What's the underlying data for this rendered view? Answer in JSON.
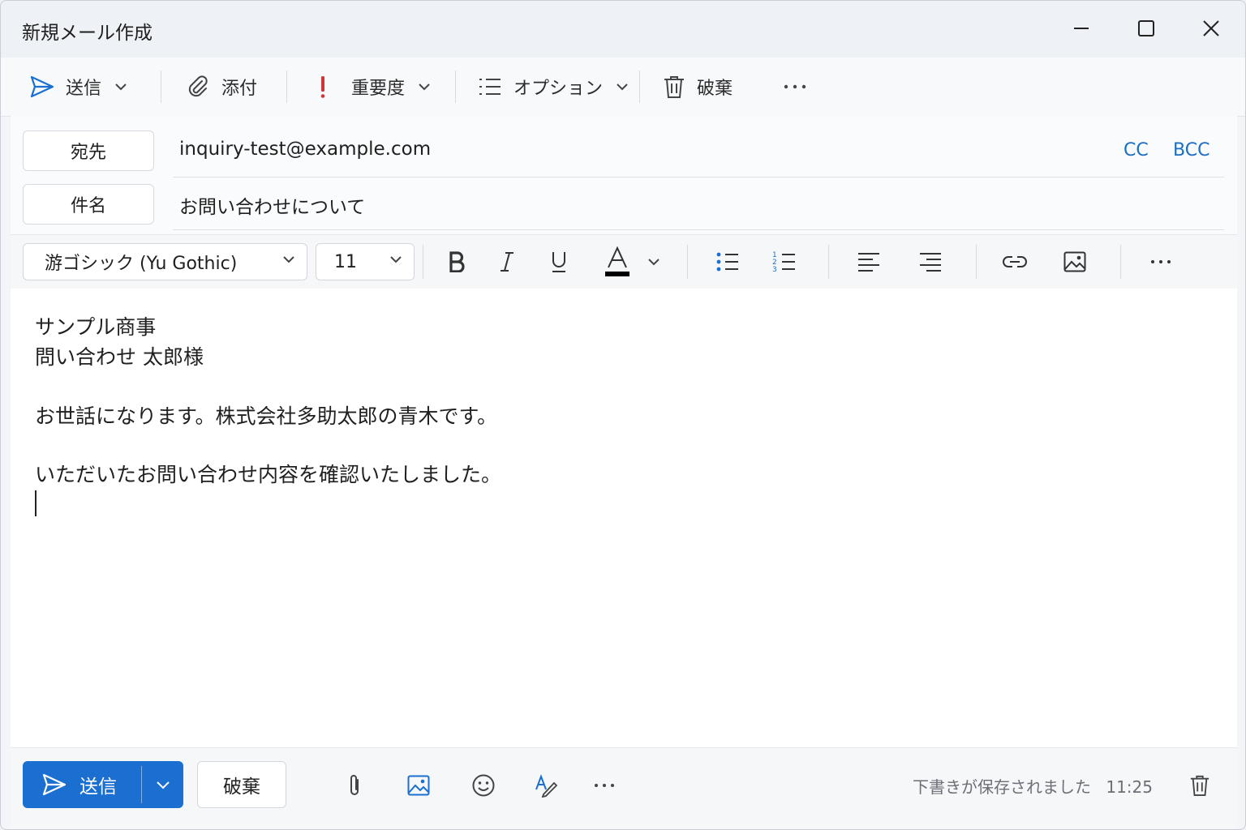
{
  "window": {
    "title": "新規メール作成"
  },
  "toolbar": {
    "send_label": "送信",
    "attach_label": "添付",
    "importance_label": "重要度",
    "options_label": "オプション",
    "discard_label": "破棄",
    "importance_color": "#d13438",
    "accent_color": "#1a6fd1"
  },
  "headers": {
    "to_label": "宛先",
    "to_value": "inquiry-test@example.com",
    "cc_label": "CC",
    "bcc_label": "BCC",
    "subject_label": "件名",
    "subject_value": "お問い合わせについて"
  },
  "format": {
    "font_family_value": "游ゴシック (Yu Gothic)",
    "font_size_value": "11",
    "icons": [
      "bold-icon",
      "italic-icon",
      "underline-icon",
      "font-color-icon",
      "bullet-list-icon",
      "numbered-list-icon",
      "align-left-icon",
      "align-right-icon",
      "link-icon",
      "image-icon",
      "more-icon"
    ]
  },
  "body": {
    "lines": [
      "サンプル商事",
      "問い合わせ 太郎様",
      "お世話になります。株式会社多助太郎の青木です。",
      "いただいたお問い合わせ内容を確認いたしました。"
    ]
  },
  "footer": {
    "send_label": "送信",
    "discard_label": "破棄",
    "status_text": "下書きが保存されました",
    "status_time": "11:25"
  }
}
